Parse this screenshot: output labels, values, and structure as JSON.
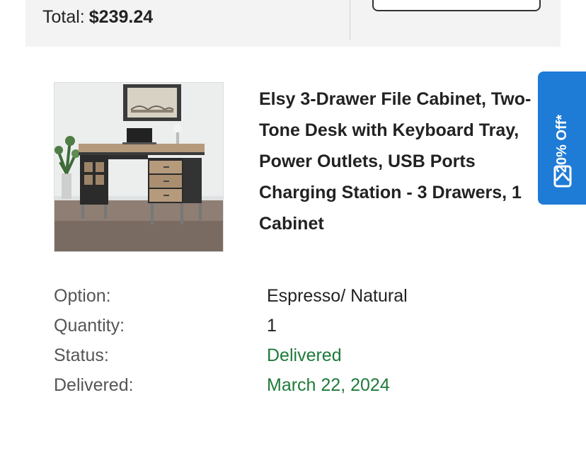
{
  "summary": {
    "total_label": "Total:",
    "total_amount": "$239.24"
  },
  "product": {
    "title": "Elsy 3-Drawer File Cabinet, Two-Tone Desk with Keyboard Tray, Power Outlets, USB Ports Charging Station - 3 Drawers, 1 Cabinet",
    "image_icon": "desk-product-photo"
  },
  "details": [
    {
      "label": "Option:",
      "value": "Espresso/ Natural",
      "status_color": ""
    },
    {
      "label": "Quantity:",
      "value": "1",
      "status_color": ""
    },
    {
      "label": "Status:",
      "value": "Delivered",
      "status_color": "#1f7a3a"
    },
    {
      "label": "Delivered:",
      "value": "March 22, 2024",
      "status_color": "#1f7a3a"
    }
  ],
  "promo": {
    "label": "20% Off*",
    "icon": "mail-coupon-icon",
    "color": "#1e7bd6"
  },
  "colors": {
    "panel_bg": "#f3f3f3",
    "text": "#222222",
    "label": "#555555",
    "success": "#1f7a3a",
    "accent": "#1e7bd6"
  }
}
